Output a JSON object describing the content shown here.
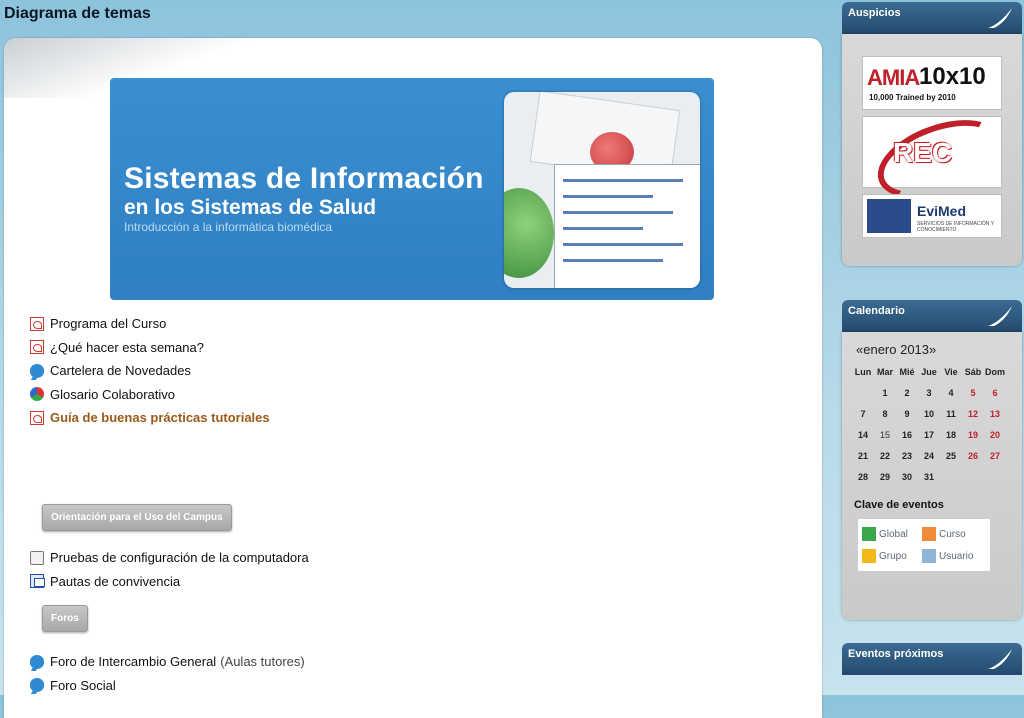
{
  "page_title": "Diagrama de temas",
  "banner": {
    "title": "Sistemas de Información",
    "subtitle": "en los Sistemas de Salud",
    "subtitle2": "Introducción a la informática biomédica"
  },
  "links": [
    {
      "label": "Programa del Curso",
      "icon": "pdf-icon"
    },
    {
      "label": "¿Qué hacer esta semana?",
      "icon": "pdf-icon"
    },
    {
      "label": "Cartelera de Novedades",
      "icon": "forum-icon"
    },
    {
      "label": "Glosario Colaborativo",
      "icon": "glossary-icon"
    },
    {
      "label": "Guía de buenas prácticas tutoriales",
      "icon": "pdf-icon"
    }
  ],
  "orientation_button": "Orientación para el Uso del Campus",
  "links2": [
    {
      "label": "Pruebas de configuración de la computadora",
      "icon": "page-icon"
    },
    {
      "label": "Pautas de convivencia",
      "icon": "chat-icon"
    }
  ],
  "foros_button": "Foros",
  "links3": [
    {
      "label": "Foro de Intercambio General",
      "suffix": "(Aulas tutores)",
      "icon": "forum-icon"
    },
    {
      "label": "Foro Social",
      "icon": "forum-icon"
    }
  ],
  "sidebar": {
    "sponsors_title": "Auspicios",
    "sponsors": {
      "ami_a": "AMIA",
      "ami_b": "10x10",
      "ami_c": "10,000 Trained by 2010",
      "rec": "REC",
      "evimed": "EviMed",
      "evimed_sub": "SERVICIOS DE INFORMACIÓN Y CONOCIMIENTO"
    },
    "calendar_title": "Calendario",
    "calendar_month": "«enero 2013»",
    "weekdays": [
      "Lun",
      "Mar",
      "Mié",
      "Jue",
      "Vie",
      "Sáb",
      "Dom"
    ],
    "weeks": [
      [
        "",
        "1",
        "2",
        "3",
        "4",
        "5",
        "6"
      ],
      [
        "7",
        "8",
        "9",
        "10",
        "11",
        "12",
        "13"
      ],
      [
        "14",
        "15",
        "16",
        "17",
        "18",
        "19",
        "20"
      ],
      [
        "21",
        "22",
        "23",
        "24",
        "25",
        "26",
        "27"
      ],
      [
        "28",
        "29",
        "30",
        "31",
        "",
        "",
        ""
      ]
    ],
    "events_key_title": "Clave de eventos",
    "legend": {
      "global": "Global",
      "curso": "Curso",
      "grupo": "Grupo",
      "usuario": "Usuario",
      "colors": {
        "global": "#3aa84a",
        "curso": "#f08a3a",
        "grupo": "#f2b81a",
        "usuario": "#8fb6d8"
      }
    },
    "upcoming_title": "Eventos próximos"
  }
}
